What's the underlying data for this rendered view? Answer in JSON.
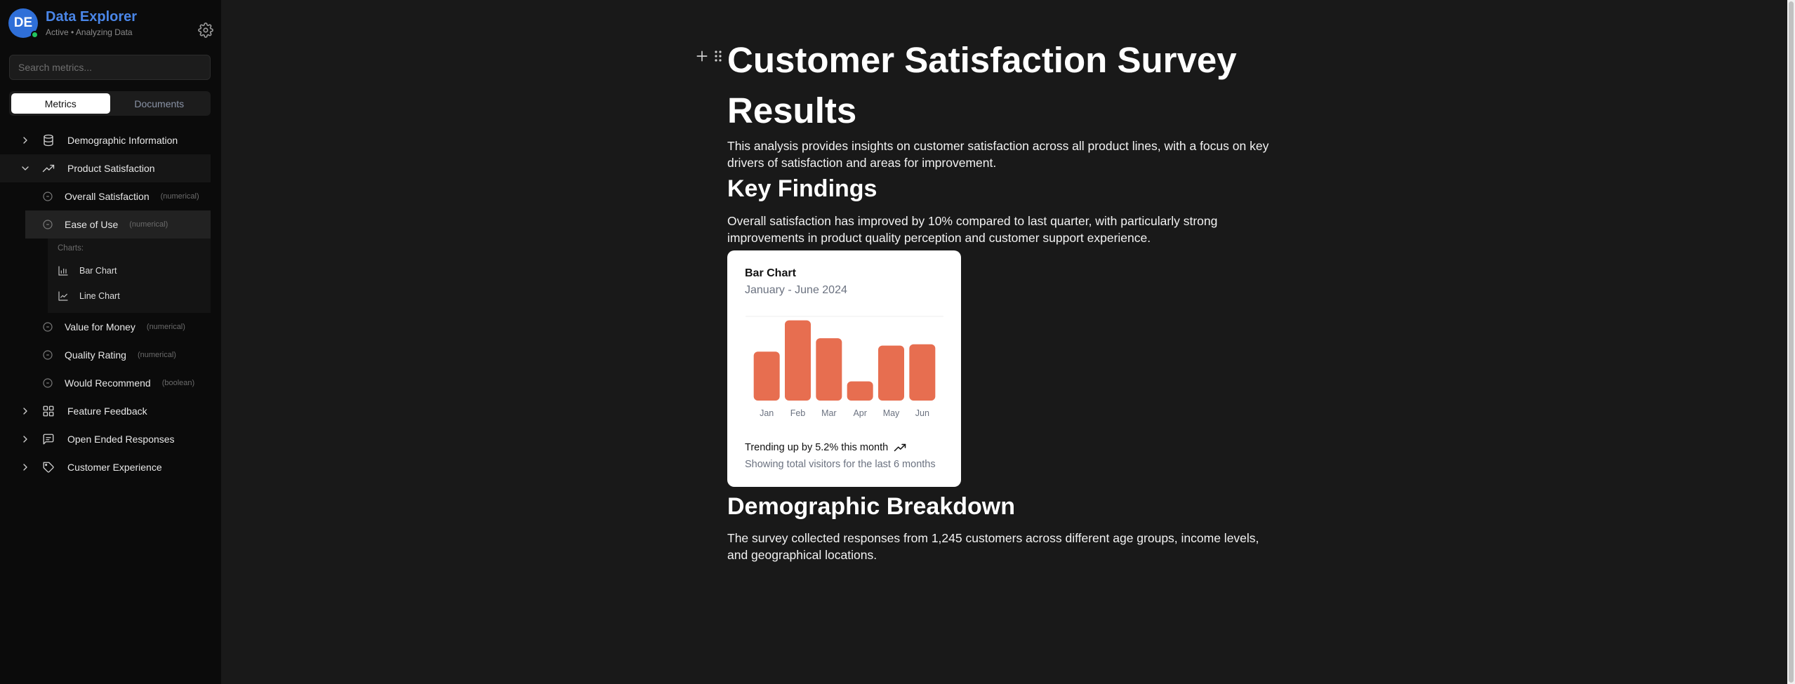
{
  "sidebar": {
    "app_title": "Data Explorer",
    "avatar_initials": "DE",
    "status": "Active • Analyzing Data",
    "search_placeholder": "Search metrics...",
    "tabs": [
      {
        "label": "Metrics",
        "active": true
      },
      {
        "label": "Documents",
        "active": false
      }
    ],
    "groups": [
      {
        "label": "Demographic Information",
        "icon": "database-icon",
        "expanded": false
      },
      {
        "label": "Product Satisfaction",
        "icon": "trending-up-icon",
        "expanded": true,
        "metrics": [
          {
            "label": "Overall Satisfaction",
            "type": "(numerical)"
          },
          {
            "label": "Ease of Use",
            "type": "(numerical)",
            "selected": true,
            "charts_label": "Charts:",
            "charts": [
              {
                "label": "Bar Chart",
                "icon": "bar-chart-icon"
              },
              {
                "label": "Line Chart",
                "icon": "line-chart-icon"
              }
            ]
          },
          {
            "label": "Value for Money",
            "type": "(numerical)"
          },
          {
            "label": "Quality Rating",
            "type": "(numerical)"
          },
          {
            "label": "Would Recommend",
            "type": "(boolean)"
          }
        ]
      },
      {
        "label": "Feature Feedback",
        "icon": "grid-icon",
        "expanded": false
      },
      {
        "label": "Open Ended Responses",
        "icon": "message-square-icon",
        "expanded": false
      },
      {
        "label": "Customer Experience",
        "icon": "tag-icon",
        "expanded": false
      }
    ]
  },
  "document": {
    "title": "Customer Satisfaction Survey Results",
    "intro": "This analysis provides insights on customer satisfaction across all product lines, with a focus on key drivers of satisfaction and areas for improvement.",
    "key_findings_heading": "Key Findings",
    "key_findings_text": "Overall satisfaction has improved by 10% compared to last quarter, with particularly strong improvements in product quality perception and customer support experience.",
    "demographic_heading": "Demographic Breakdown",
    "demographic_text": "The survey collected responses from 1,245 customers across different age groups, income levels, and geographical locations."
  },
  "chart_card": {
    "title": "Bar Chart",
    "subtitle": "January - June 2024",
    "trend_text": "Trending up by 5.2% this month",
    "footer": "Showing total visitors for the last 6 months"
  },
  "chart_data": {
    "type": "bar",
    "title": "Bar Chart",
    "subtitle": "January - June 2024",
    "categories": [
      "Jan",
      "Feb",
      "Mar",
      "Apr",
      "May",
      "Jun"
    ],
    "values": [
      186,
      305,
      237,
      73,
      209,
      214
    ],
    "ylim": [
      0,
      320
    ],
    "grid": true,
    "bar_color": "#e76e50"
  },
  "colors": {
    "accent": "#4a86e8",
    "status_online": "#22c55e",
    "bar": "#e76e50"
  }
}
